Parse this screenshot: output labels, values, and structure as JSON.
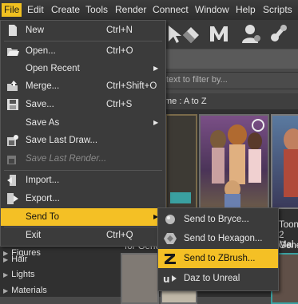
{
  "menubar": [
    "File",
    "Edit",
    "Create",
    "Tools",
    "Render",
    "Connect",
    "Window",
    "Help",
    "Scripts"
  ],
  "filter_placeholder": "text to filter by...",
  "sort_label": "me : A to Z",
  "categories": [
    "Figures",
    "Hair",
    "Lights",
    "Materials"
  ],
  "thumb_captions": {
    "left": "for Gene",
    "right": [
      "Toon",
      "2 Mal",
      "Gene"
    ]
  },
  "file_menu": [
    {
      "label": "New",
      "shortcut": "Ctrl+N",
      "icon": "new-document-icon"
    },
    {
      "label": "Open...",
      "shortcut": "Ctrl+O",
      "icon": "open-folder-icon"
    },
    {
      "label": "Open Recent",
      "submenu": true
    },
    {
      "label": "Merge...",
      "shortcut": "Ctrl+Shift+O",
      "icon": "merge-icon"
    },
    {
      "label": "Save...",
      "shortcut": "Ctrl+S",
      "icon": "save-icon"
    },
    {
      "label": "Save As",
      "submenu": true
    },
    {
      "label": "Save Last Draw...",
      "icon": "save-draw-icon"
    },
    {
      "label": "Save Last Render...",
      "disabled": true,
      "icon": "save-render-icon"
    },
    {
      "label": "Import...",
      "icon": "import-icon"
    },
    {
      "label": "Export...",
      "icon": "export-icon"
    },
    {
      "label": "Send To",
      "submenu": true,
      "highlighted": true
    },
    {
      "label": "Exit",
      "shortcut": "Ctrl+Q"
    }
  ],
  "submenu_arrow": "▶",
  "send_to_menu": [
    {
      "label": "Send to Bryce...",
      "icon": "bryce-icon"
    },
    {
      "label": "Send to Hexagon...",
      "icon": "hexagon-icon"
    },
    {
      "label": "Send to ZBrush...",
      "icon": "zbrush-icon",
      "highlighted": true
    },
    {
      "label": "Daz to Unreal",
      "icon": "unreal-icon"
    }
  ],
  "colors": {
    "highlight": "#f4c025",
    "menu_bg": "#3b3b3b"
  }
}
